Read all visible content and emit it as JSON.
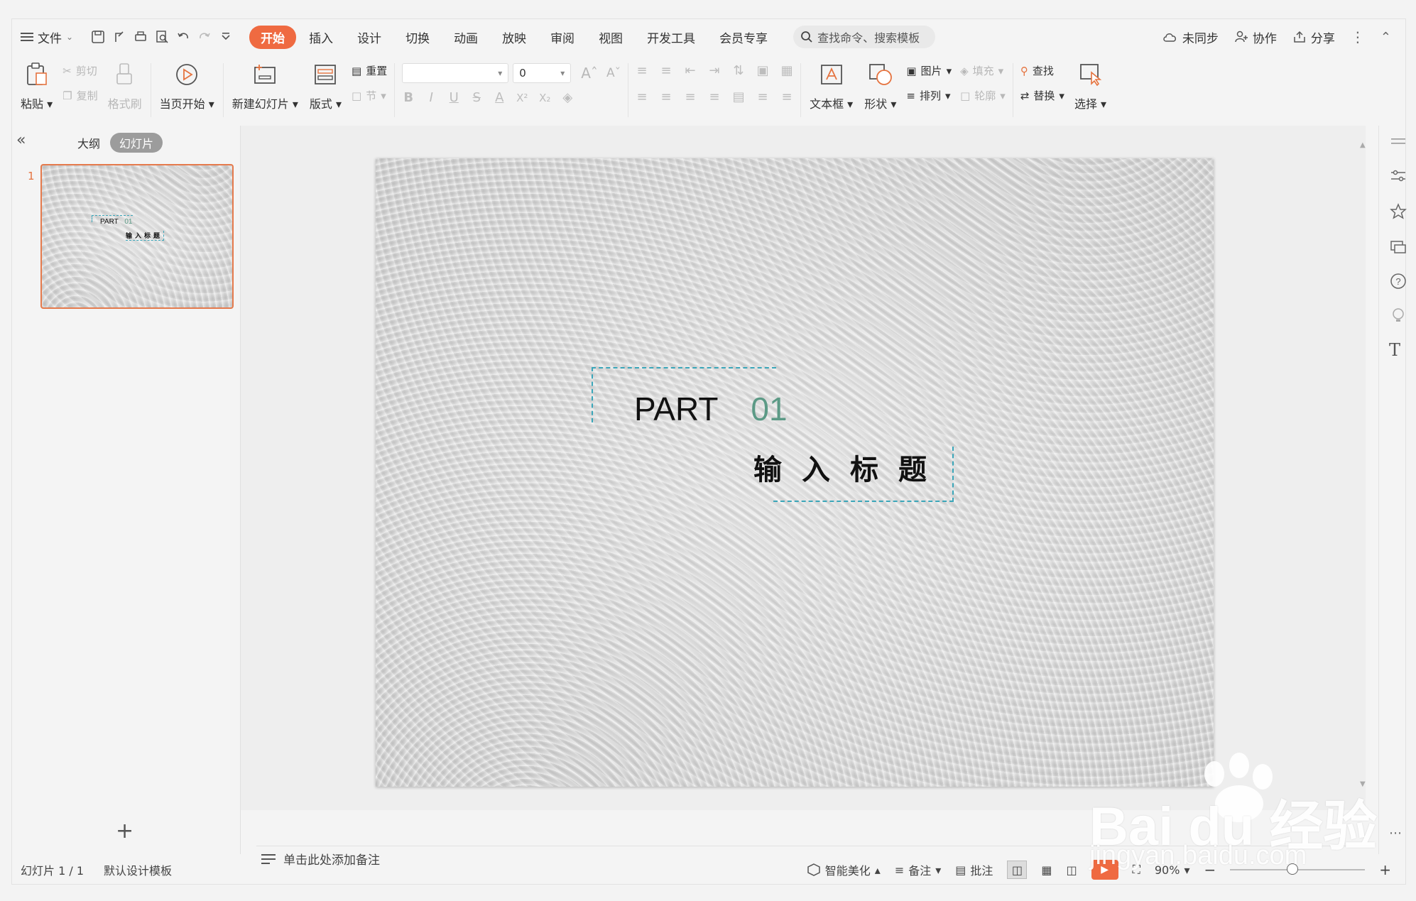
{
  "menu": {
    "file": "文件",
    "tabs": [
      "开始",
      "插入",
      "设计",
      "切换",
      "动画",
      "放映",
      "审阅",
      "视图",
      "开发工具",
      "会员专享"
    ],
    "active_tab": "开始",
    "search_placeholder": "查找命令、搜索模板",
    "right": {
      "sync": "未同步",
      "collab": "协作",
      "share": "分享"
    }
  },
  "ribbon": {
    "paste": "粘贴",
    "cut": "剪切",
    "copy": "复制",
    "format_painter": "格式刷",
    "play_current": "当页开始",
    "new_slide": "新建幻灯片",
    "layout": "版式",
    "reset": "重置",
    "section": "节",
    "font_size": "0",
    "textbox": "文本框",
    "shape": "形状",
    "picture": "图片",
    "fill": "填充",
    "arrange": "排列",
    "outline": "轮廓",
    "find": "查找",
    "replace": "替换",
    "select": "选择"
  },
  "leftpanel": {
    "tab_outline": "大纲",
    "tab_slides": "幻灯片",
    "slide_number": "1"
  },
  "slide": {
    "part_label": "PART",
    "part_number": "01",
    "title": "输入标题"
  },
  "thumb": {
    "part_label": "PART",
    "part_number": "01",
    "title": "输入标题"
  },
  "notes": {
    "placeholder": "单击此处添加备注"
  },
  "status": {
    "slide_count": "幻灯片 1 / 1",
    "template": "默认设计模板",
    "beautify": "智能美化",
    "notes": "备注",
    "comments": "批注",
    "zoom": "90%"
  },
  "colors": {
    "accent": "#ef6a41",
    "dashed_box": "#3aa6b9",
    "number_green": "#5c9a86"
  },
  "watermark": {
    "brand": "Bai du 经验",
    "url": "jingyan.baidu.com"
  }
}
